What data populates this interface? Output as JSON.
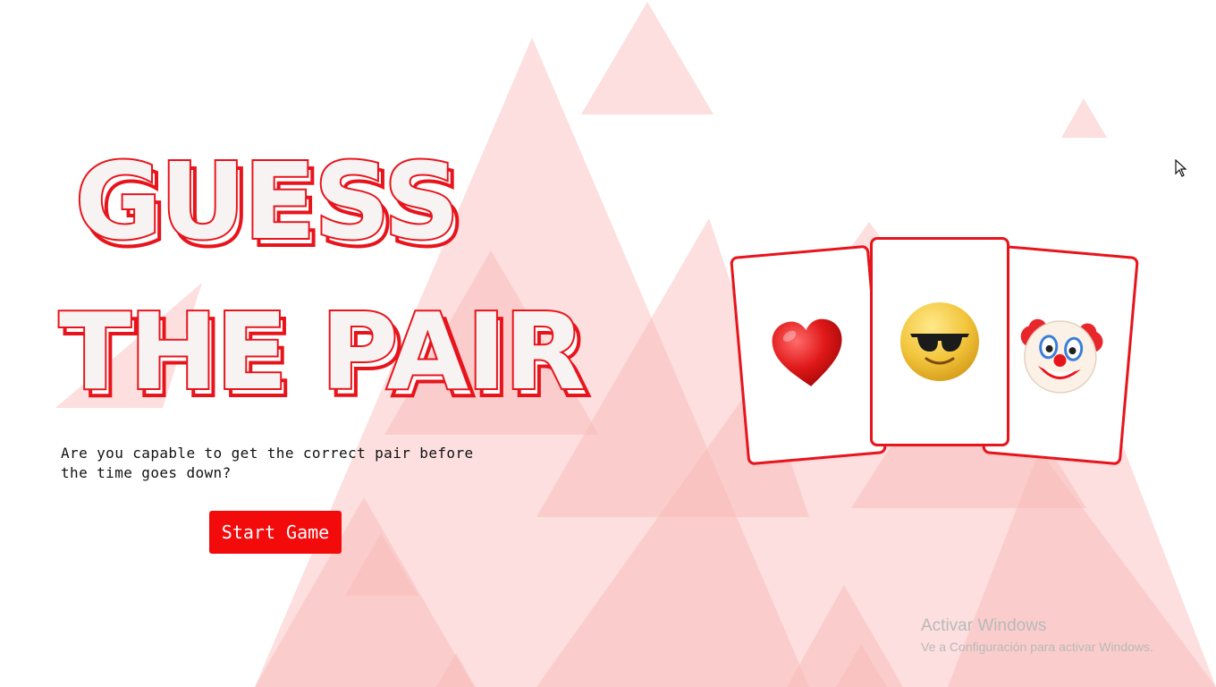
{
  "title": {
    "line1": "GUESS",
    "line2": "THE PAIR"
  },
  "tagline": "Are you capable to get the correct pair before the time goes down?",
  "start_button": {
    "label": "Start Game"
  },
  "cards": [
    {
      "emoji": "red-heart-icon"
    },
    {
      "emoji": "smiling-face-with-sunglasses-icon"
    },
    {
      "emoji": "clown-face-icon"
    }
  ],
  "colors": {
    "accent": "#e8141c",
    "button": "#f30a0a",
    "background_triangles": "#fbd0cf",
    "text": "#111111"
  },
  "watermark": {
    "title": "Activar Windows",
    "subtitle": "Ve a Configuración para activar Windows."
  }
}
